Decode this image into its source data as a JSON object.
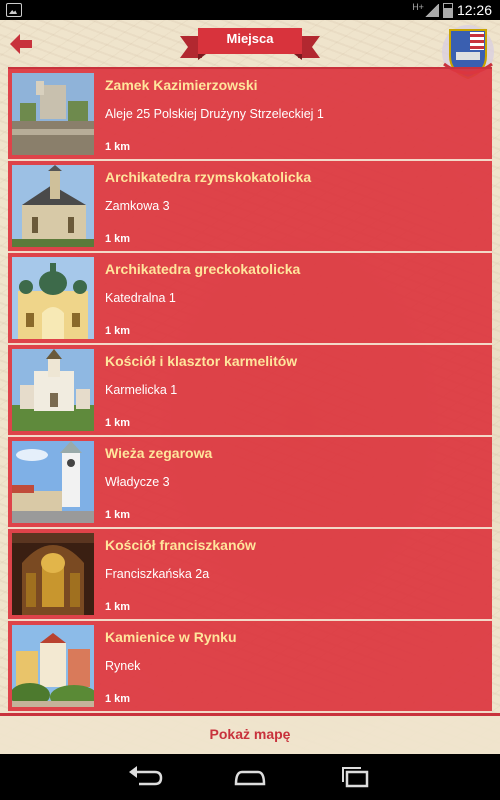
{
  "status_bar": {
    "time": "12:26",
    "network": "H+",
    "icons": [
      "gallery-notification-icon",
      "signal-icon",
      "battery-icon"
    ]
  },
  "header": {
    "title": "Miejsca",
    "back_icon": "arrow-left-icon",
    "crest_icon": "city-coat-of-arms-icon"
  },
  "places": [
    {
      "name": "Zamek Kazimierzowski",
      "address": "Aleje 25 Polskiej Drużyny Strzeleckiej 1",
      "distance": "1 km"
    },
    {
      "name": "Archikatedra rzymskokatolicka",
      "address": "Zamkowa 3",
      "distance": "1 km"
    },
    {
      "name": "Archikatedra  greckokatolicka",
      "address": "Katedralna 1",
      "distance": "1 km"
    },
    {
      "name": "Kościół i klasztor karmelitów",
      "address": "Karmelicka 1",
      "distance": "1 km"
    },
    {
      "name": "Wieża zegarowa",
      "address": "Władycze 3",
      "distance": "1 km"
    },
    {
      "name": "Kościół franciszkanów",
      "address": "Franciszkańska 2a",
      "distance": "1 km"
    },
    {
      "name": "Kamienice w Rynku",
      "address": "Rynek",
      "distance": "1 km"
    }
  ],
  "footer": {
    "show_map_label": "Pokaż mapę"
  },
  "nav_bar": {
    "icons": [
      "back-nav-icon",
      "home-nav-icon",
      "recent-apps-icon"
    ]
  },
  "colors": {
    "item_bg": "#dd373f",
    "title": "#ffe59c",
    "accent": "#c8323c",
    "parchment": "#efe4cc"
  }
}
